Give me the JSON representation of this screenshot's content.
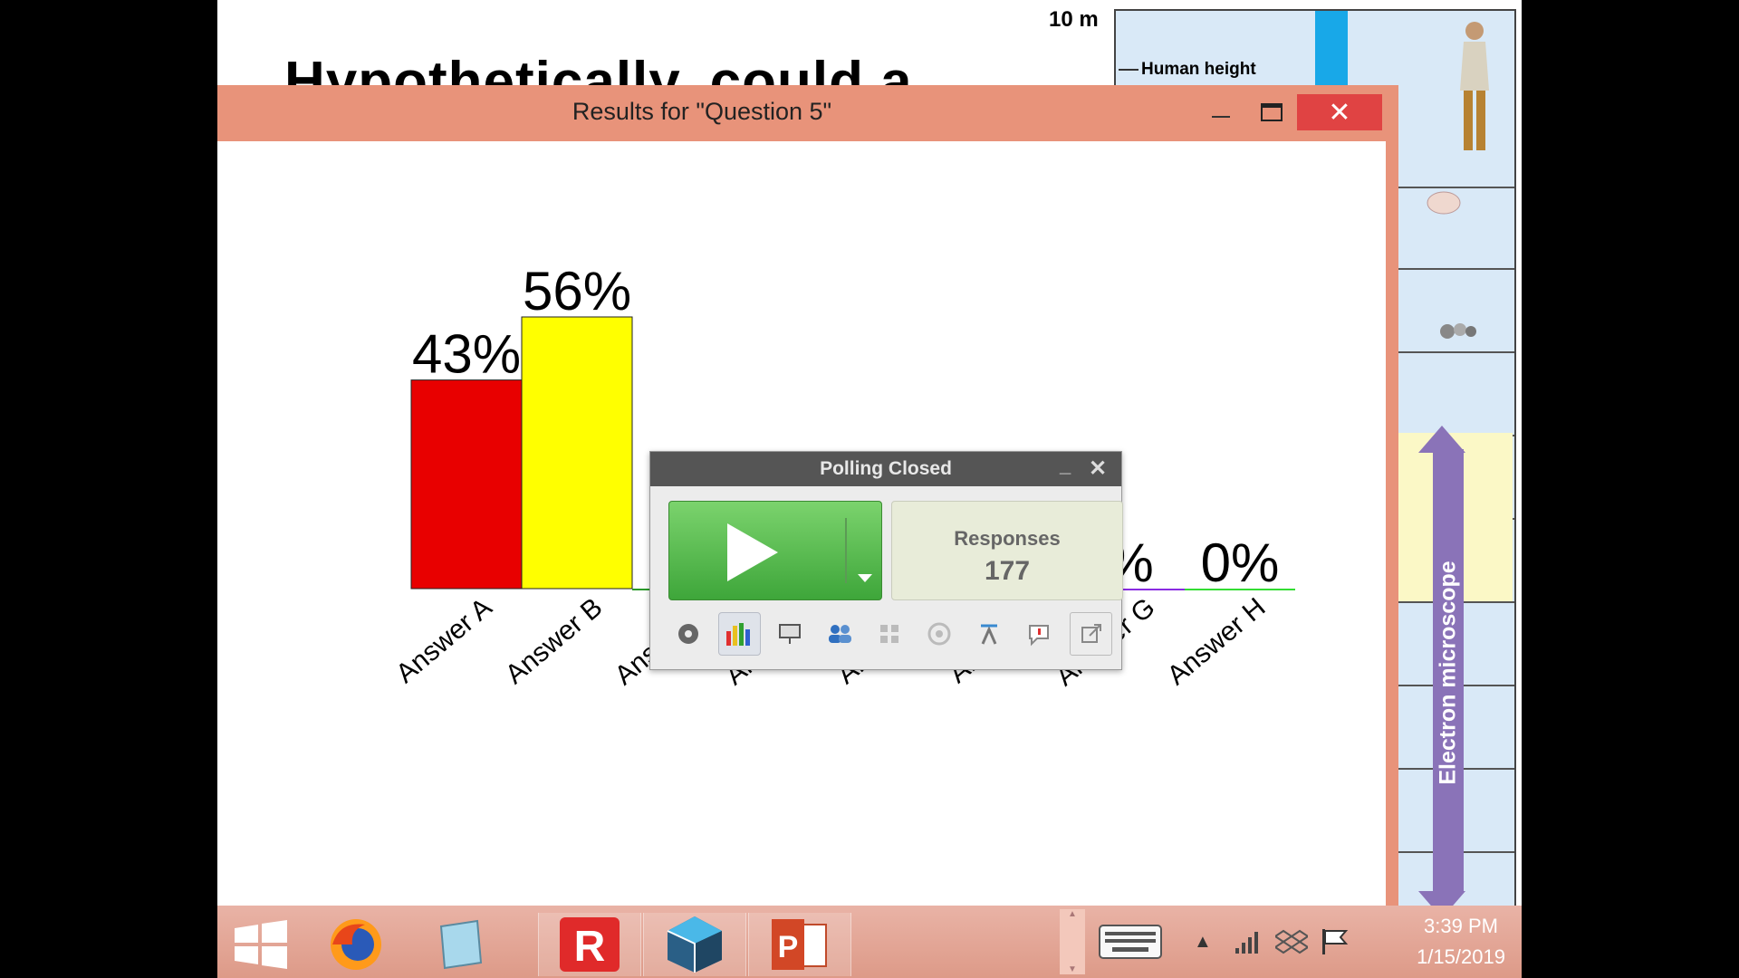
{
  "slide": {
    "title": "Hypothetically, could a",
    "scale_label": "10 m",
    "human_label": "Human height",
    "instrument_label": "Electron microscope"
  },
  "results_window": {
    "title": "Results for \"Question 5\"",
    "minimize_label": "—",
    "close_label": "✕"
  },
  "chart_data": {
    "type": "bar",
    "categories": [
      "Answer A",
      "Answer B",
      "Answer C",
      "Answer D",
      "Answer E",
      "Answer F",
      "Answer G",
      "Answer H"
    ],
    "values": [
      43,
      56,
      0,
      0,
      0,
      0,
      0,
      0
    ],
    "value_labels": [
      "43%",
      "56%",
      "",
      "",
      "",
      "",
      "%",
      "0%"
    ],
    "colors": [
      "#e80000",
      "#ffff00",
      "#2a9a2a",
      "#ff9900",
      "#3333cc",
      "#22aaaa",
      "#8a2be2",
      "#33dd33"
    ],
    "ylim": [
      0,
      56
    ]
  },
  "poll": {
    "title": "Polling Closed",
    "minimize_label": "_",
    "close_label": "✕",
    "responses_label": "Responses",
    "responses_count": "177"
  },
  "taskbar": {
    "time": "3:39 PM",
    "date": "1/15/2019",
    "apps": [
      "windows-start",
      "firefox",
      "notepad",
      "turningpoint",
      "sketchup",
      "powerpoint"
    ]
  },
  "colors": {
    "titlebar": "#e8937a",
    "close": "#e04343",
    "play": "#4cb944"
  }
}
